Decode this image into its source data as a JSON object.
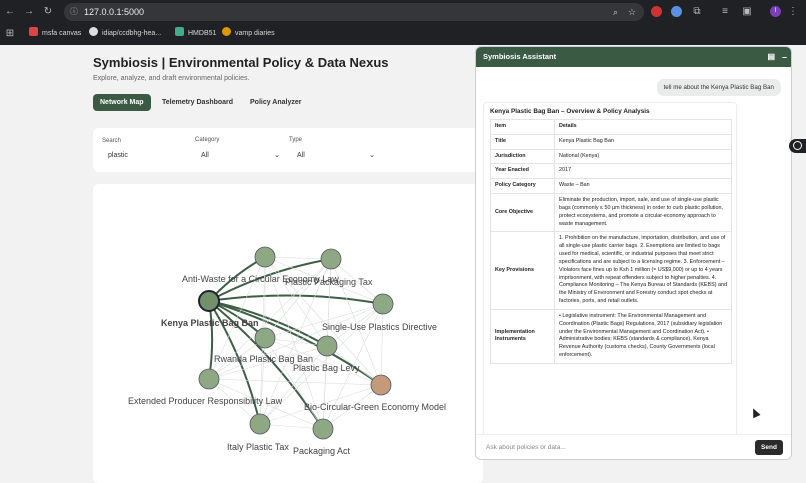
{
  "browser": {
    "url": "127.0.0.1:5000"
  },
  "bookmarks": [
    {
      "label": "msfa canvas",
      "color": "#d44"
    },
    {
      "label": "idiap/ccdbhg-hea...",
      "color": "#ddd"
    },
    {
      "label": "HMDB51",
      "color": "#4a8"
    },
    {
      "label": "vamp diaries",
      "color": "#d90"
    }
  ],
  "page": {
    "title": "Symbiosis | Environmental Policy & Data Nexus",
    "subtitle": "Explore, analyze, and draft environmental policies."
  },
  "tabs": [
    {
      "label": "Network Map",
      "active": true
    },
    {
      "label": "Telemetry Dashboard",
      "active": false
    },
    {
      "label": "Policy Analyzer",
      "active": false
    }
  ],
  "filters": {
    "search_label": "Search",
    "search_value": "plastic",
    "category_label": "Category",
    "category_value": "All",
    "type_label": "Type",
    "type_value": "All"
  },
  "graph": {
    "nodes": [
      {
        "label": "Kenya Plastic Bag Ban",
        "bold": true
      },
      {
        "label": "Anti-Waste for a Circular Economy Law"
      },
      {
        "label": "Plastic Packaging Tax"
      },
      {
        "label": "Single-Use Plastics Directive"
      },
      {
        "label": "Rwanda Plastic Bag Ban"
      },
      {
        "label": "Plastic Bag Levy"
      },
      {
        "label": "Extended Producer Responsibility Law"
      },
      {
        "label": "Bio-Circular-Green Economy Model"
      },
      {
        "label": "Italy Plastic Tax"
      },
      {
        "label": "Packaging Act"
      }
    ]
  },
  "assistant": {
    "title": "Symbiosis Assistant",
    "user_message": "tell me about the Kenya Plastic Bag Ban",
    "answer_title": "Kenya Plastic Bag Ban – Overview & Policy Analysis",
    "table_head": {
      "item": "Item",
      "details": "Details"
    },
    "rows": [
      {
        "k": "Title",
        "v": "Kenya Plastic Bag Ban"
      },
      {
        "k": "Jurisdiction",
        "v": "National (Kenya)"
      },
      {
        "k": "Year Enacted",
        "v": "2017"
      },
      {
        "k": "Policy Category",
        "v": "Waste – Ban"
      },
      {
        "k": "Core Objective",
        "v": "Eliminate the production, import, sale, and use of single-use plastic bags (commonly ≤ 50 µm thickness) in order to curb plastic pollution, protect ecosystems, and promote a circular-economy approach to waste management."
      },
      {
        "k": "Key Provisions",
        "v": "1. Prohibition on the manufacture, importation, distribution, and use of all single-use plastic carrier bags. 2. Exemptions are limited to bags used for medical, scientific, or industrial purposes that meet strict specifications and are subject to a licensing regime. 3. Enforcement – Violators face fines up to Ksh 1 million (≈ US$9,000) or up to 4 years imprisonment, with repeat offenders subject to higher penalties. 4. Compliance Monitoring – The Kenya Bureau of Standards (KEBS) and the Ministry of Environment and Forestry conduct spot checks at factories, ports, and retail outlets."
      },
      {
        "k": "Implementation Instruments",
        "v": "• Legislative instrument: The Environmental Management and Coordination (Plastic Bags) Regulations, 2017 (subsidiary legislation under the Environmental Management and Coordination Act). • Administrative bodies: KEBS (standards & compliance), Kenya Revenue Authority (customs checks), County Governments (local enforcement)."
      }
    ],
    "input_placeholder": "Ask about policies or data...",
    "send_label": "Send"
  },
  "colors": {
    "accent": "#3a5a44",
    "node": "#8fa884",
    "highlight_node": "#c49a78"
  }
}
